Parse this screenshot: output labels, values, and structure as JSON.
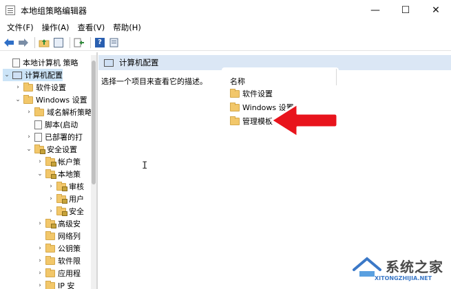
{
  "window": {
    "title": "本地组策略编辑器",
    "controls": {
      "minimize": "—",
      "maximize": "☐",
      "close": "✕"
    }
  },
  "menu": [
    "文件(F)",
    "操作(A)",
    "查看(V)",
    "帮助(H)"
  ],
  "toolbar": {
    "buttons": [
      "back-icon",
      "forward-icon",
      "up-folder-icon",
      "show-hide-tree-icon",
      "export-list-icon",
      "help-icon",
      "properties-icon"
    ]
  },
  "tree": [
    {
      "label": "本地计算机 策略",
      "icon": "doc-icon",
      "level": 0,
      "chevron": ""
    },
    {
      "label": "计算机配置",
      "icon": "pc-icon",
      "level": 0,
      "chevron": "⌄",
      "selected": true
    },
    {
      "label": "软件设置",
      "icon": "folder-icon",
      "level": 1,
      "chevron": "›"
    },
    {
      "label": "Windows 设置",
      "icon": "folder-icon",
      "level": 1,
      "chevron": "⌄"
    },
    {
      "label": "域名解析策略",
      "icon": "folder-icon",
      "level": 2,
      "chevron": "›"
    },
    {
      "label": "脚本(启动",
      "icon": "doc-icon",
      "level": 2,
      "chevron": ""
    },
    {
      "label": "已部署的打",
      "icon": "printer-icon",
      "level": 2,
      "chevron": "›"
    },
    {
      "label": "安全设置",
      "icon": "shield-icon",
      "level": 2,
      "chevron": "⌄"
    },
    {
      "label": "帐户策",
      "icon": "folder-lock-icon",
      "level": 3,
      "chevron": "›"
    },
    {
      "label": "本地策",
      "icon": "folder-lock-icon",
      "level": 3,
      "chevron": "⌄"
    },
    {
      "label": "审核",
      "icon": "folder-lock-icon",
      "level": 4,
      "chevron": "›"
    },
    {
      "label": "用户",
      "icon": "folder-lock-icon",
      "level": 4,
      "chevron": "›"
    },
    {
      "label": "安全",
      "icon": "folder-lock-icon",
      "level": 4,
      "chevron": "›"
    },
    {
      "label": "高级安",
      "icon": "folder-lock-icon",
      "level": 3,
      "chevron": "›"
    },
    {
      "label": "网络列",
      "icon": "folder-icon",
      "level": 3,
      "chevron": ""
    },
    {
      "label": "公钥策",
      "icon": "folder-icon",
      "level": 3,
      "chevron": "›"
    },
    {
      "label": "软件限",
      "icon": "folder-icon",
      "level": 3,
      "chevron": "›"
    },
    {
      "label": "应用程",
      "icon": "folder-icon",
      "level": 3,
      "chevron": "›"
    },
    {
      "label": "IP 安",
      "icon": "folder-icon",
      "level": 3,
      "chevron": "›"
    }
  ],
  "right_pane": {
    "header": "计算机配置",
    "description": "选择一个项目来查看它的描述。",
    "column_name": "名称",
    "items": [
      "软件设置",
      "Windows 设置",
      "管理模板"
    ]
  },
  "annotation": {
    "arrow_color": "#e8141c"
  },
  "watermark": {
    "main": "系统之家",
    "sub": "XITONGZHIJIA.NET"
  }
}
